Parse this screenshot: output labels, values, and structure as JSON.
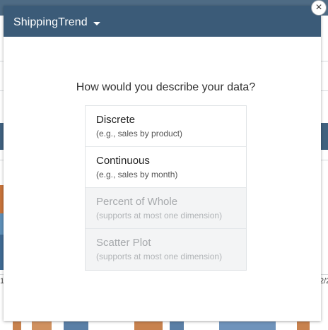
{
  "dialog": {
    "title": "ShippingTrend",
    "close_symbol": "×",
    "question": "How would you describe your data?"
  },
  "options": [
    {
      "title": "Discrete",
      "subtitle": "(e.g., sales by product)",
      "enabled": true
    },
    {
      "title": "Continuous",
      "subtitle": "(e.g., sales by month)",
      "enabled": true
    },
    {
      "title": "Percent of Whole",
      "subtitle": "(supports at most one dimension)",
      "enabled": false
    },
    {
      "title": "Scatter Plot",
      "subtitle": "(supports at most one dimension)",
      "enabled": false
    }
  ],
  "background": {
    "left_fragment": "1",
    "right_fragment": "2/2"
  },
  "colors": {
    "header": "#3b5b78",
    "disabled_row": "#f3f4f5"
  }
}
